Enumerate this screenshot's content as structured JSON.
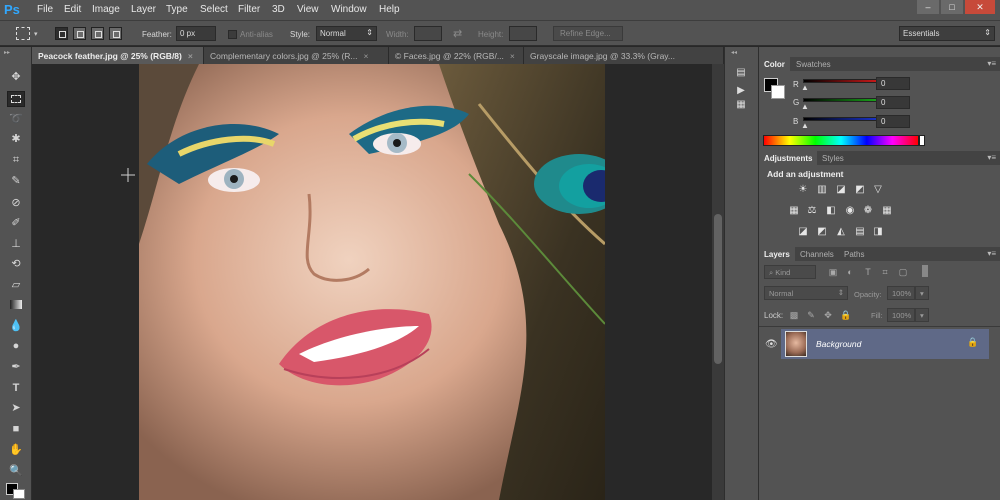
{
  "app": {
    "logo": "Ps"
  },
  "menu": [
    "File",
    "Edit",
    "Image",
    "Layer",
    "Type",
    "Select",
    "Filter",
    "3D",
    "View",
    "Window",
    "Help"
  ],
  "window_controls": {
    "minimize": "–",
    "restore": "□",
    "close": "✕"
  },
  "options": {
    "feather_label": "Feather:",
    "feather_value": "0 px",
    "antialias_label": "Anti-alias",
    "style_label": "Style:",
    "style_value": "Normal",
    "width_label": "Width:",
    "height_label": "Height:",
    "refine_edge": "Refine Edge...",
    "workspace": "Essentials"
  },
  "tabs": [
    {
      "label": "Peacock feather.jpg @ 25% (RGB/8)",
      "active": true
    },
    {
      "label": "Complementary colors.jpg @ 25% (R...",
      "active": false
    },
    {
      "label": "© Faces.jpg @ 22% (RGB/...",
      "active": false
    },
    {
      "label": "Grayscale image.jpg @ 33.3% (Gray...",
      "active": false
    }
  ],
  "tab_close": "×",
  "color_panel": {
    "tabs": [
      "Color",
      "Swatches"
    ],
    "channels": [
      {
        "label": "R",
        "value": "0",
        "color": "#ff2020"
      },
      {
        "label": "G",
        "value": "0",
        "color": "#20d020"
      },
      {
        "label": "B",
        "value": "0",
        "color": "#2040ff"
      }
    ]
  },
  "adjustments_panel": {
    "tabs": [
      "Adjustments",
      "Styles"
    ],
    "heading": "Add an adjustment"
  },
  "layers_panel": {
    "tabs": [
      "Layers",
      "Channels",
      "Paths"
    ],
    "kind_filter": "⌕ Kind",
    "blend_mode": "Normal",
    "opacity_label": "Opacity:",
    "opacity_value": "100%",
    "lock_label": "Lock:",
    "fill_label": "Fill:",
    "fill_value": "100%",
    "layers": [
      {
        "name": "Background",
        "visible": true,
        "locked": true
      }
    ]
  },
  "panel_menu_glyph": "▾≡",
  "accent_color": "#31a8ff"
}
